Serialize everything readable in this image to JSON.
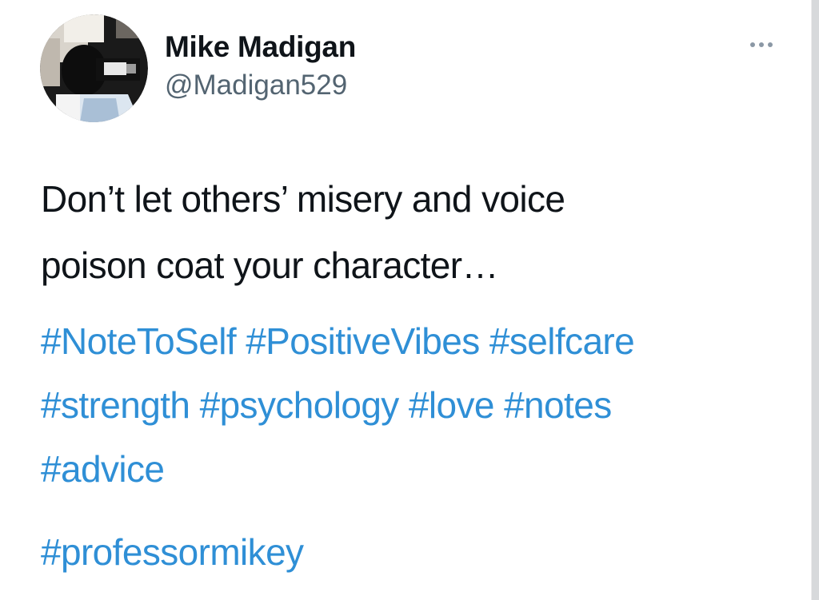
{
  "author": {
    "display_name": "Mike Madigan",
    "handle": "@Madigan529"
  },
  "tweet": {
    "text_lines": [
      "Don’t let others’ misery and voice",
      "poison coat your character…"
    ],
    "hashtag_lines": [
      [
        "#NoteToSelf",
        "#PositiveVibes",
        "#selfcare"
      ],
      [
        "#strength",
        "#psychology",
        "#love",
        "#notes"
      ],
      [
        "#advice"
      ]
    ],
    "final_hashtag": "#professormikey"
  },
  "icons": {
    "more": "more-options-icon",
    "avatar": "profile-photo"
  },
  "colors": {
    "hashtag": "#2f8fd6",
    "text": "#0f1419",
    "handle": "#536471",
    "more_dots": "#8b98a5"
  }
}
